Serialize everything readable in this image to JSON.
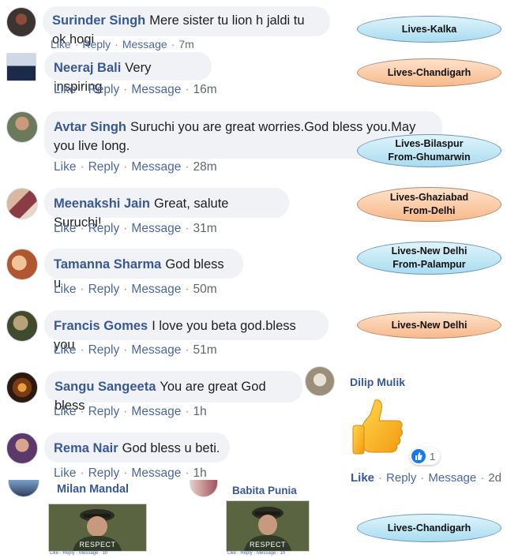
{
  "comments": [
    {
      "name": "Surinder Singh",
      "text": "Mere sister tu lion h jaldi tu ok hogi",
      "like": "Like",
      "reply": "Reply",
      "message": "Message",
      "time": "7m"
    },
    {
      "name": "Neeraj Bali",
      "text": "Very inspiring",
      "like": "Like",
      "reply": "Reply",
      "message": "Message",
      "time": "16m"
    },
    {
      "name": "Avtar Singh",
      "text": "Suruchi you are great worries.God bless you.May you live long.",
      "like": "Like",
      "reply": "Reply",
      "message": "Message",
      "time": "28m"
    },
    {
      "name": "Meenakshi Jain",
      "text": "Great, salute Suruchi!",
      "like": "Like",
      "reply": "Reply",
      "message": "Message",
      "time": "31m"
    },
    {
      "name": "Tamanna Sharma",
      "text": "God bless u",
      "like": "Like",
      "reply": "Reply",
      "message": "Message",
      "time": "50m"
    },
    {
      "name": "Francis Gomes",
      "text": "I love you beta god.bless you",
      "like": "Like",
      "reply": "Reply",
      "message": "Message",
      "time": "51m"
    },
    {
      "name": "Sangu Sangeeta",
      "text": "You are great God bless",
      "like": "Like",
      "reply": "Reply",
      "message": "Message",
      "time": "1h"
    },
    {
      "name": "Rema Nair",
      "text": "God bless u beti.",
      "like": "Like",
      "reply": "Reply",
      "message": "Message",
      "time": "1h"
    }
  ],
  "dilip": {
    "name": "Dilip Mulik",
    "reaction_count": "1",
    "like": "Like",
    "reply": "Reply",
    "message": "Message",
    "time": "2d"
  },
  "milan": {
    "name": "Milan Mandal",
    "gif_caption": "RESPECT",
    "actions": "Like · Reply · Message · 1h"
  },
  "babita": {
    "name": "Babita Punia",
    "gif_caption": "RESPECT",
    "actions": "Like · Reply · Message · 1h"
  },
  "locations": [
    {
      "line1": "Lives-Kalka",
      "line2": "",
      "color": "blue"
    },
    {
      "line1": "Lives-Chandigarh",
      "line2": "",
      "color": "orange"
    },
    {
      "line1": "Lives-Bilaspur",
      "line2": "From-Ghumarwin",
      "color": "blue"
    },
    {
      "line1": "Lives-Ghaziabad",
      "line2": "From-Delhi",
      "color": "orange"
    },
    {
      "line1": "Lives-New Delhi",
      "line2": "From-Palampur",
      "color": "blue"
    },
    {
      "line1": "Lives-New Delhi",
      "line2": "",
      "color": "orange"
    },
    {
      "line1": "Lives-Chandigarh",
      "line2": "",
      "color": "blue"
    }
  ],
  "colors": {
    "name": "#385898",
    "bubble": "#f0f2f5",
    "action": "#4b67a1",
    "like_badge": "#1877f2",
    "blue_label": "#bfe7f6",
    "orange_label": "#fbcaa4"
  }
}
